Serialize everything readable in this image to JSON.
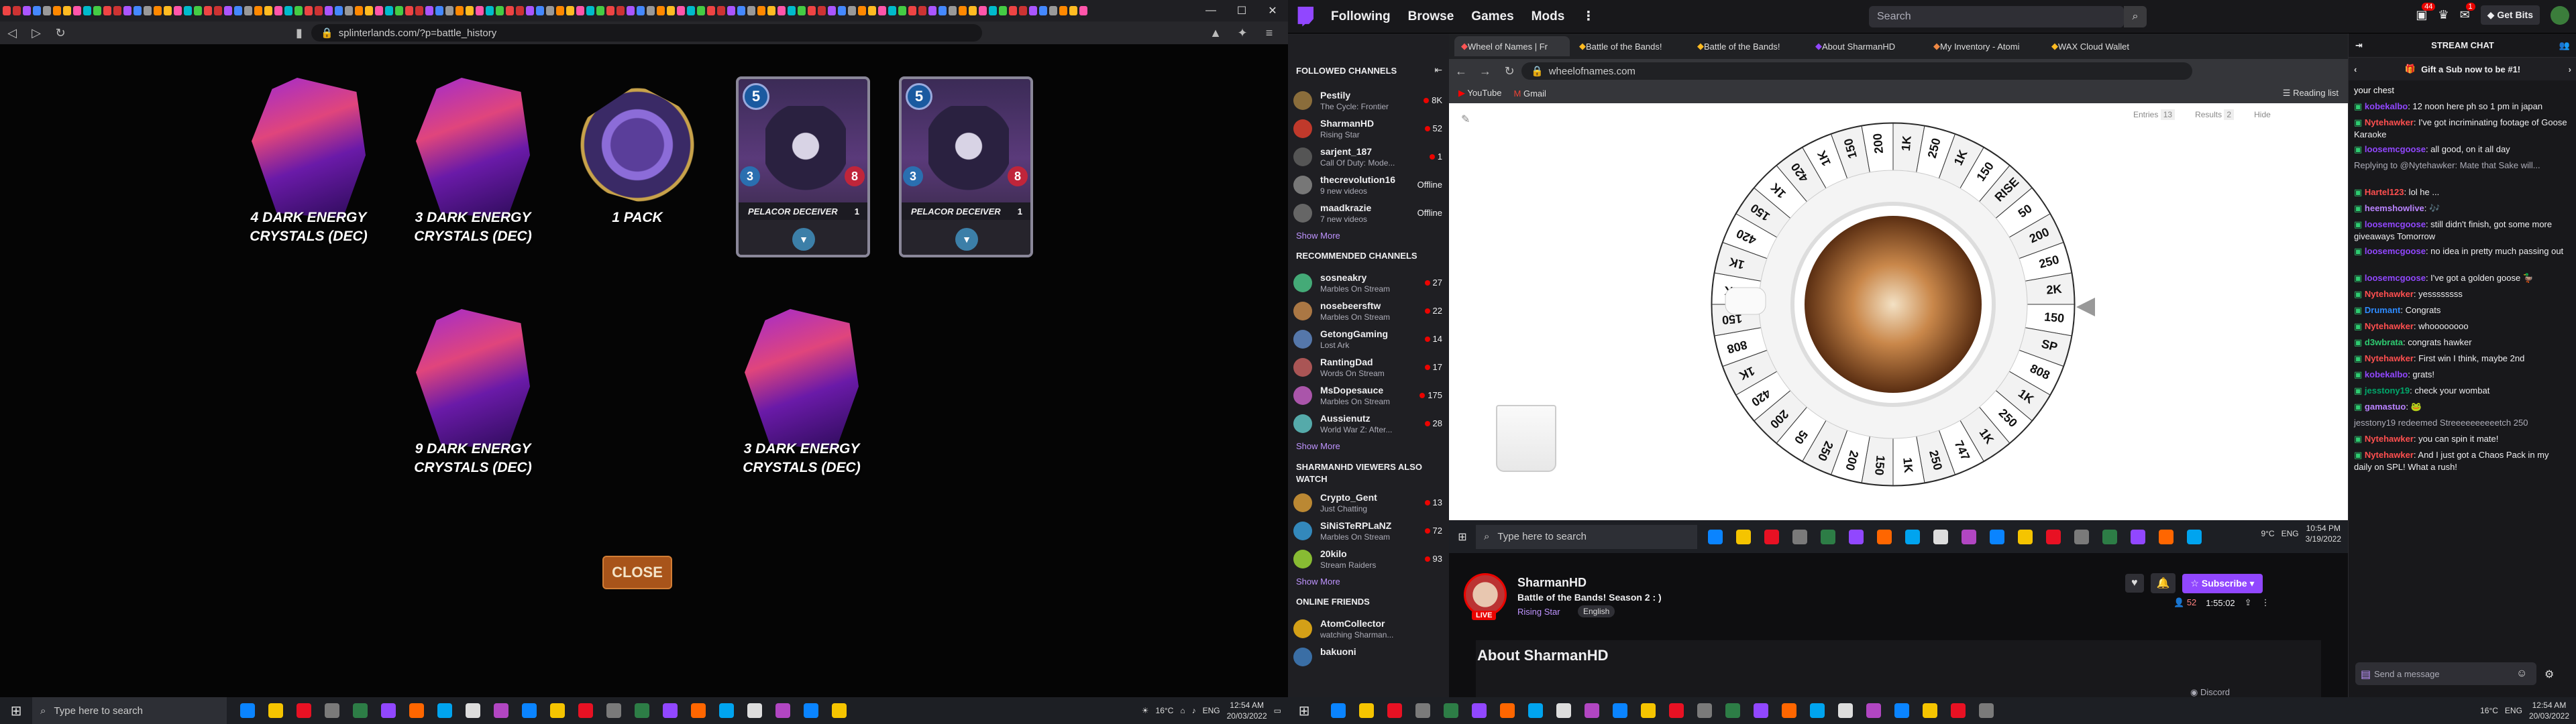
{
  "left_browser": {
    "url": "splinterlands.com/?p=battle_history"
  },
  "rewards": {
    "items": [
      {
        "label": "4 DARK ENERGY CRYSTALS (DEC)"
      },
      {
        "label": "3 DARK ENERGY CRYSTALS (DEC)"
      },
      {
        "label": "1 PACK"
      },
      {
        "label": "9 DARK ENERGY CRYSTALS (DEC)"
      },
      {
        "label": "3 DARK ENERGY CRYSTALS (DEC)"
      }
    ],
    "cards": [
      {
        "name": "PELACOR DECEIVER",
        "level": "1",
        "mana": "5",
        "speed": "3",
        "health": "8"
      },
      {
        "name": "PELACOR DECEIVER",
        "level": "1",
        "mana": "5",
        "speed": "3",
        "health": "8"
      }
    ],
    "close_label": "CLOSE"
  },
  "taskbar_left": {
    "search_placeholder": "Type here to search",
    "weather": "16°C",
    "lang": "ENG",
    "time": "12:54 AM",
    "date": "20/03/2022"
  },
  "twitch": {
    "nav": {
      "following": "Following",
      "browse": "Browse",
      "games": "Games",
      "mods": "Mods",
      "search_placeholder": "Search",
      "get_bits": "Get Bits",
      "badge_notif": "44",
      "badge_inbox": "1"
    },
    "followed_title": "FOLLOWED CHANNELS",
    "followed": [
      {
        "name": "Pestily",
        "game": "The Cycle: Frontier",
        "viewers": "8K",
        "color": "#8a6d3b"
      },
      {
        "name": "SharmanHD",
        "game": "Rising Star",
        "viewers": "52",
        "color": "#c0392b"
      },
      {
        "name": "sarjent_187",
        "game": "Call Of Duty: Mode...",
        "viewers": "1",
        "color": "#555"
      },
      {
        "name": "thecrevolution16",
        "game": "9 new videos",
        "viewers": "Offline",
        "color": "#777"
      },
      {
        "name": "maadkrazie",
        "game": "7 new videos",
        "viewers": "Offline",
        "color": "#666"
      }
    ],
    "show_more": "Show More",
    "recommended_title": "RECOMMENDED CHANNELS",
    "recommended": [
      {
        "name": "sosneakry",
        "game": "Marbles On Stream",
        "viewers": "27",
        "color": "#4a7"
      },
      {
        "name": "nosebeersftw",
        "game": "Marbles On Stream",
        "viewers": "22",
        "color": "#a74"
      },
      {
        "name": "GetongGaming",
        "game": "Lost Ark",
        "viewers": "14",
        "color": "#57a"
      },
      {
        "name": "RantingDad",
        "game": "Words On Stream",
        "viewers": "17",
        "color": "#a55"
      },
      {
        "name": "MsDopesauce",
        "game": "Marbles On Stream",
        "viewers": "175",
        "color": "#a5a"
      },
      {
        "name": "Aussienutz",
        "game": "World War Z: After...",
        "viewers": "28",
        "color": "#5aa"
      }
    ],
    "also_watch_title": "SHARMANHD VIEWERS ALSO WATCH",
    "also_watch": [
      {
        "name": "Crypto_Gent",
        "game": "Just Chatting",
        "viewers": "13",
        "color": "#b83"
      },
      {
        "name": "SiNiSTeRPLaNZ",
        "game": "Marbles On Stream",
        "viewers": "72",
        "color": "#38b"
      },
      {
        "name": "20kilo",
        "game": "Stream Raiders",
        "viewers": "93",
        "color": "#8b3"
      }
    ],
    "online_friends_title": "ONLINE FRIENDS",
    "friends": [
      {
        "name": "AtomCollector",
        "game": "watching Sharman...",
        "color": "#d4a017"
      },
      {
        "name": "bakuoni",
        "game": "",
        "color": "#3a6ea5"
      }
    ],
    "browser_tabs": [
      "Wheel of Names | Fr",
      "Battle of the Bands!",
      "Battle of the Bands!",
      "About SharmanHD",
      "My Inventory - Atomi",
      "WAX Cloud Wallet"
    ],
    "wheel_url": "wheelofnames.com",
    "bookmarks": [
      "YouTube",
      "Gmail"
    ],
    "reading_list": "Reading list",
    "wheel_tabs": {
      "entries": "Entries",
      "entries_count": "13",
      "results": "Results",
      "results_count": "2",
      "hide": "Hide"
    },
    "wheel_segments": [
      "1K",
      "250",
      "1K",
      "150",
      "RISE",
      "50",
      "200",
      "250",
      "2K",
      "150",
      "SP",
      "808",
      "1K",
      "250",
      "1K",
      "747",
      "250",
      "1K",
      "150",
      "200",
      "250",
      "50",
      "200",
      "420",
      "1K",
      "808",
      "150",
      "2K",
      "1K",
      "420",
      "150",
      "1K",
      "420",
      "1K",
      "150",
      "200"
    ],
    "inner_taskbar": {
      "search_placeholder": "Type here to search",
      "weather": "9°C",
      "lang": "ENG",
      "time": "10:54 PM",
      "date": "3/19/2022"
    },
    "streamer": {
      "name": "SharmanHD",
      "title": "Battle of the Bands! Season 2 : )",
      "game": "Rising Star",
      "tag": "English",
      "live": "LIVE",
      "viewers": "52",
      "uptime": "1:55:02",
      "subscribe": "Subscribe",
      "about": "About SharmanHD",
      "discord": "Discord"
    },
    "chat": {
      "title": "STREAM CHAT",
      "gift": "Gift a Sub now to be #1!",
      "input_placeholder": "Send a message",
      "messages": [
        {
          "user": "",
          "text": "your chest",
          "color": "#fff"
        },
        {
          "user": "kobekalbo",
          "text": ": 12 noon here ph so 1 pm in japan",
          "color": "#9147ff"
        },
        {
          "user": "Nytehawker",
          "text": ": I've got incriminating footage of Goose Karaoke",
          "color": "#ff4f4f"
        },
        {
          "user": "loosemcgoose",
          "text": ": all good, on it all day",
          "color": "#9147ff"
        },
        {
          "user": "",
          "text": "Replying to @Nytehawker: Mate that Sake will...",
          "color": "#adadb8"
        },
        {
          "user": "Hartel123",
          "text": ": lol he ...",
          "color": "#ff4f4f"
        },
        {
          "user": "heemshowlive",
          "text": ": 🎶",
          "color": "#b983ff"
        },
        {
          "user": "loosemcgoose",
          "text": ": still didn't finish, got some more giveaways Tomorrow",
          "color": "#9147ff"
        },
        {
          "user": "loosemcgoose",
          "text": ": no idea in pretty much passing out",
          "color": "#9147ff"
        },
        {
          "user": "loosemcgoose",
          "text": ": I've got a golden goose 🦆",
          "color": "#9147ff"
        },
        {
          "user": "Nytehawker",
          "text": ": yessssssss",
          "color": "#ff4f4f"
        },
        {
          "user": "Drumant",
          "text": ": Congrats",
          "color": "#2e8bff"
        },
        {
          "user": "Nytehawker",
          "text": ": whoooooooo",
          "color": "#ff4f4f"
        },
        {
          "user": "d3wbrata",
          "text": ": congrats hawker",
          "color": "#2ecc71"
        },
        {
          "user": "Nytehawker",
          "text": ": First win I think, maybe 2nd",
          "color": "#ff4f4f"
        },
        {
          "user": "kobekalbo",
          "text": ": grats!",
          "color": "#9147ff"
        },
        {
          "user": "jesstony19",
          "text": ": check your wombat",
          "color": "#00a86b"
        },
        {
          "user": "gamastuo",
          "text": ": 🐸",
          "color": "#b983ff"
        },
        {
          "user": "",
          "text": "jesstony19 redeemed Streeeeeeeeeetch 250",
          "color": "#adadb8"
        },
        {
          "user": "Nytehawker",
          "text": ": you can spin it mate!",
          "color": "#ff4f4f"
        },
        {
          "user": "Nytehawker",
          "text": ": And I just got a Chaos Pack in my daily on SPL! What a rush!",
          "color": "#ff4f4f"
        }
      ]
    }
  },
  "taskbar_right": {
    "search_placeholder": "Type here to search",
    "weather": "16°C",
    "lang": "ENG",
    "time": "12:54 AM",
    "date": "20/03/2022"
  }
}
